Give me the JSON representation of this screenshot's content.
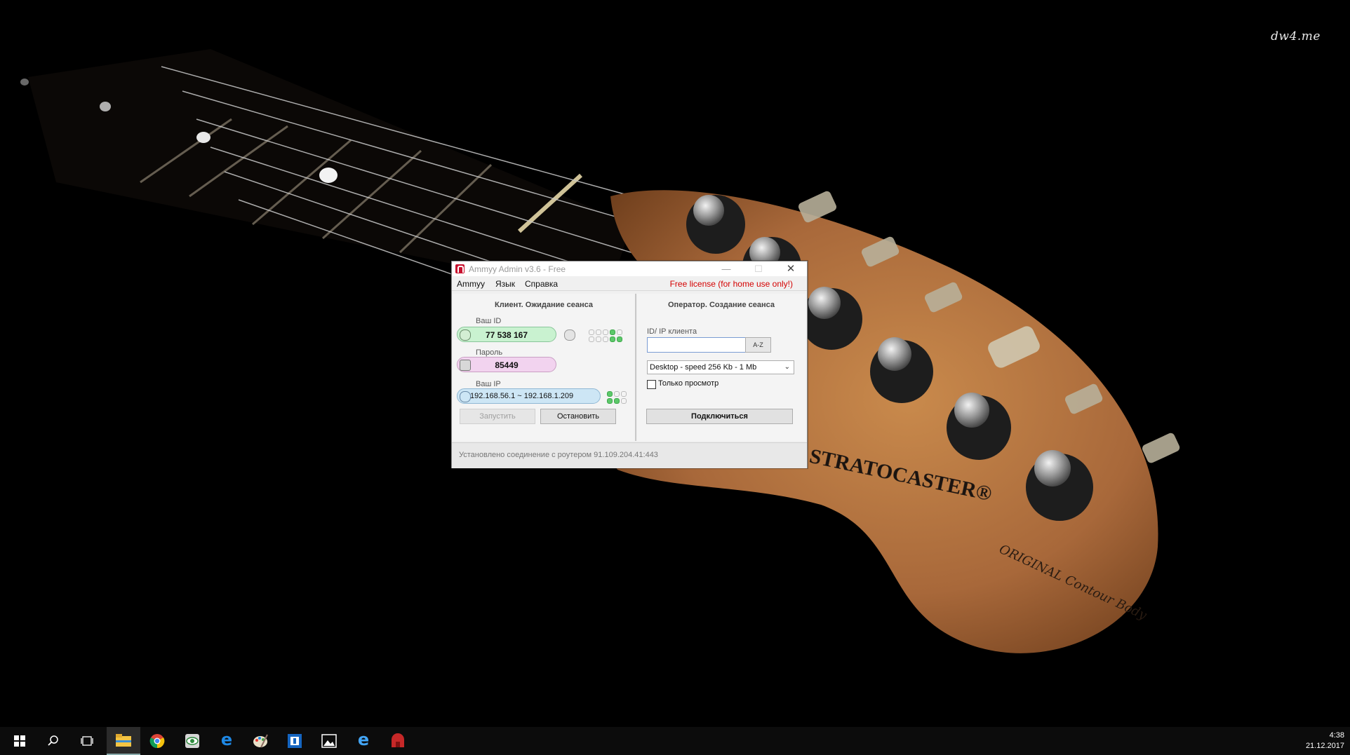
{
  "desktop": {
    "watermark": "dw4.me",
    "headstock_logo": "STRATOCASTER®",
    "headstock_sub": "ORIGINAL Contour Body"
  },
  "window": {
    "title": "Ammyy Admin v3.6 - Free",
    "controls": {
      "minimize": "—",
      "maximize": "☐",
      "close": "✕"
    },
    "menu": [
      "Ammyy",
      "Язык",
      "Справка"
    ],
    "license_text": "Free license (for home use only!)",
    "client": {
      "title": "Клиент. Ожидание сеанса",
      "id_label": "Ваш ID",
      "id_value": "77 538 167",
      "password_label": "Пароль",
      "password_value": "85449",
      "ip_label": "Ваш IP",
      "ip_value": "192.168.56.1 ~ 192.168.1.209",
      "start_button": "Запустить",
      "stop_button": "Остановить"
    },
    "operator": {
      "title": "Оператор. Создание сеанса",
      "client_id_label": "ID/ IP клиента",
      "client_id_value": "",
      "az_button": "A-Z",
      "speed_selected": "Desktop - speed  256 Kb - 1 Mb",
      "view_only_label": "Только просмотр",
      "view_only_checked": false,
      "connect_button": "Подключиться"
    },
    "status": "Установлено соединение с роутером 91.109.204.41:443"
  },
  "taskbar": {
    "icons": [
      "windows-start-icon",
      "search-icon",
      "task-view-icon",
      "file-explorer-icon",
      "chrome-icon",
      "eye-app-icon",
      "edge-icon",
      "paint-icon",
      "terminal-app-icon",
      "photos-icon",
      "internet-explorer-icon",
      "ammyy-icon"
    ],
    "time": "4:38",
    "date": "21.12.2017"
  },
  "colors": {
    "license_red": "#d40000",
    "id_green": "#c9f2d0",
    "password_pink": "#f2d3ef",
    "ip_blue": "#cde6f5",
    "status_dot_green": "#5cc86a"
  }
}
